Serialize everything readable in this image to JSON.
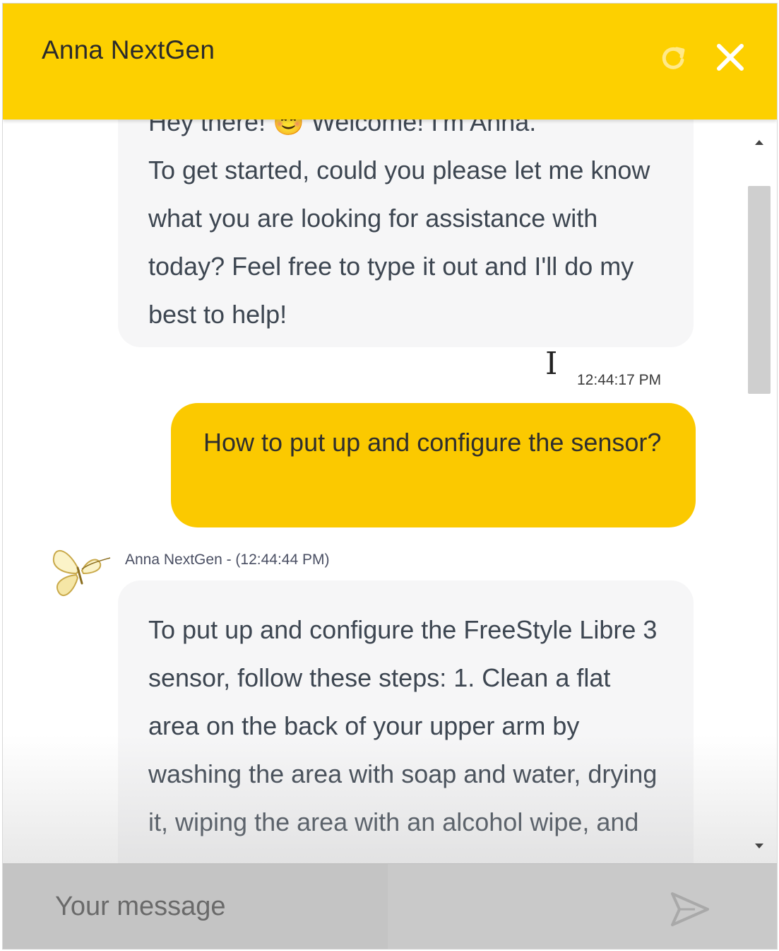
{
  "header": {
    "title": "Anna NextGen",
    "bg_color": "#fdd000",
    "refresh_icon": "refresh-icon",
    "close_icon": "close-icon"
  },
  "messages": {
    "bot_1": {
      "line_1": "Hey there! 😊 Welcome! I'm Anna.",
      "body": "To get started, could you please let me know what you are looking for assistance with today? Feel free to type it out and I'll do my best to help!",
      "time": "12:44:17 PM"
    },
    "user_1": {
      "text": "How to put up and configure the sensor?",
      "bg_color": "#fbc900"
    },
    "bot_2": {
      "meta": "Anna NextGen - (12:44:44 PM)",
      "text": "To put up and configure the FreeStyle Libre 3 sensor, follow these steps: 1. Clean a flat area on the back of your upper arm by washing the area with soap and water, drying it, wiping the area with an alcohol wipe, and",
      "avatar_icon": "butterfly-icon"
    }
  },
  "composer": {
    "placeholder": "Your message",
    "send_icon": "send-icon"
  }
}
